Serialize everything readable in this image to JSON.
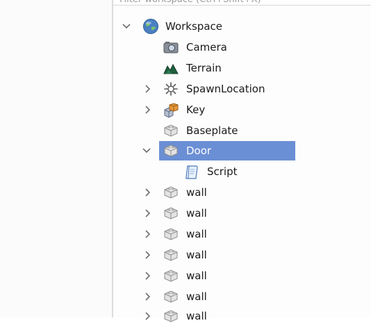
{
  "filter": {
    "placeholder": "Filter workspace (Ctrl+Shift+X)"
  },
  "tree": {
    "workspace": {
      "label": "Workspace",
      "icon": "workspace-globe-icon",
      "expanded": true
    },
    "items": [
      {
        "label": "Camera",
        "icon": "camera-icon",
        "has_children": false
      },
      {
        "label": "Terrain",
        "icon": "terrain-icon",
        "has_children": false
      },
      {
        "label": "SpawnLocation",
        "icon": "spawn-location-icon",
        "has_children": true,
        "expanded": false
      },
      {
        "label": "Key",
        "icon": "model-icon",
        "has_children": true,
        "expanded": false
      },
      {
        "label": "Baseplate",
        "icon": "part-icon",
        "has_children": false
      },
      {
        "label": "Door",
        "icon": "part-icon",
        "has_children": true,
        "expanded": true,
        "selected": true
      },
      {
        "label": "Script",
        "icon": "script-icon",
        "has_children": false,
        "child_of": "Door"
      },
      {
        "label": "wall",
        "icon": "part-icon",
        "has_children": true,
        "expanded": false
      },
      {
        "label": "wall",
        "icon": "part-icon",
        "has_children": true,
        "expanded": false
      },
      {
        "label": "wall",
        "icon": "part-icon",
        "has_children": true,
        "expanded": false
      },
      {
        "label": "wall",
        "icon": "part-icon",
        "has_children": true,
        "expanded": false
      },
      {
        "label": "wall",
        "icon": "part-icon",
        "has_children": true,
        "expanded": false
      },
      {
        "label": "wall",
        "icon": "part-icon",
        "has_children": true,
        "expanded": false
      },
      {
        "label": "wall",
        "icon": "part-icon",
        "has_children": true,
        "expanded": false
      }
    ]
  },
  "colors": {
    "selection": "#6b8fd4",
    "caret": "#6e6e6e",
    "text": "#1a1a1a"
  }
}
